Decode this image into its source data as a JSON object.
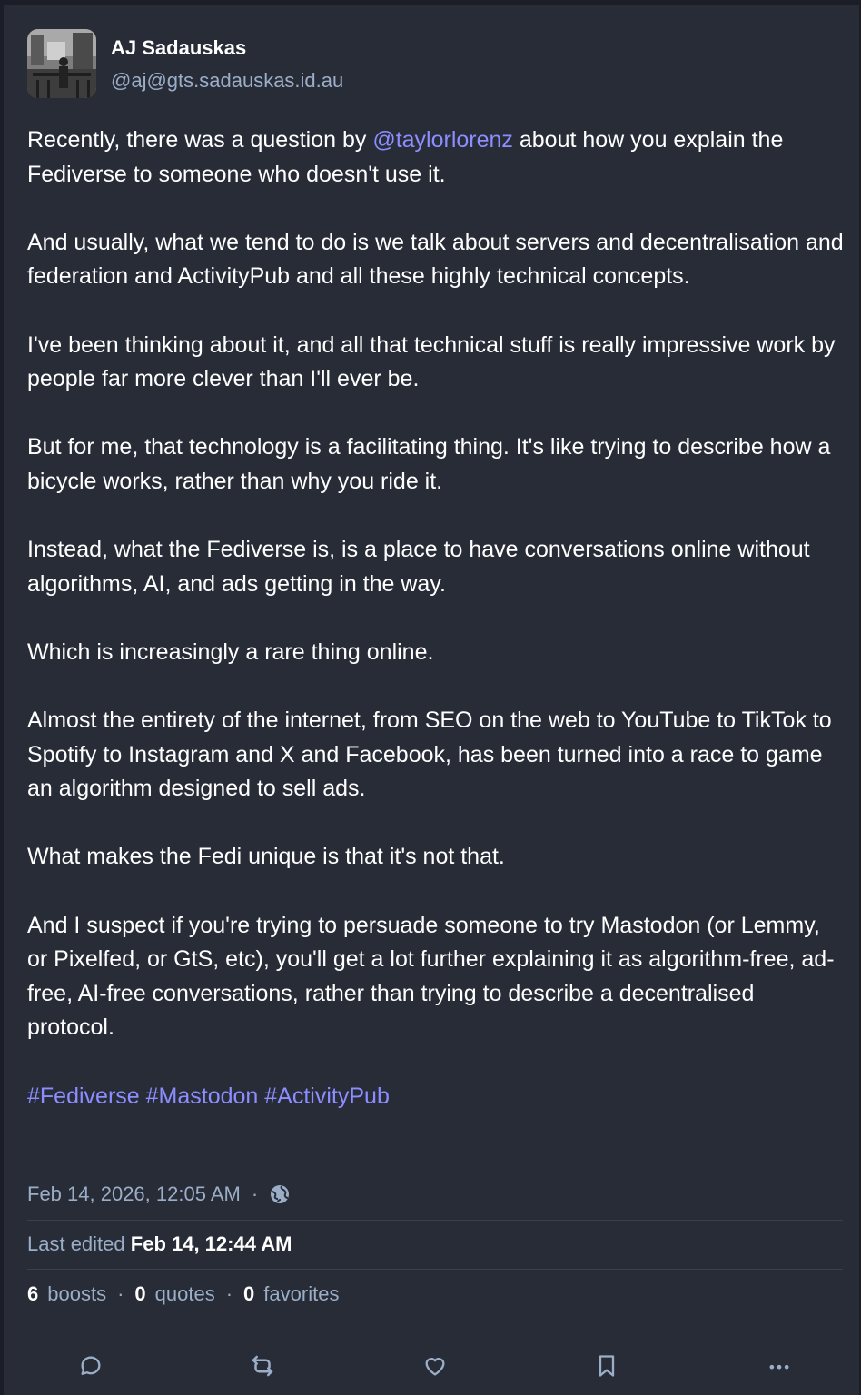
{
  "author": {
    "display_name": "AJ Sadauskas",
    "handle": "@aj@gts.sadauskas.id.au"
  },
  "post": {
    "p1_before": "Recently, there was a question by ",
    "mention": "@taylorlorenz",
    "p1_after": " about how you explain the Fediverse to someone who doesn't use it.",
    "p2": "And usually, what we tend to do is we talk about servers and decentralisation and federation and ActivityPub and all these highly technical concepts.",
    "p3": "I've been thinking about it, and all that technical stuff is really impressive work by people far more clever than I'll ever be.",
    "p4": "But for me, that technology is a facilitating thing. It's like trying to describe how a bicycle works, rather than why you ride it.",
    "p5": "Instead, what the Fediverse is, is a place to have conversations online without algorithms, AI, and ads getting in the way.",
    "p6": "Which is increasingly a rare thing online.",
    "p7": "Almost the entirety of the internet, from SEO on the web to YouTube to TikTok to Spotify to Instagram and X and Facebook, has been turned into a race to game an algorithm designed to sell ads.",
    "p8": "What makes the Fedi unique is that it's not that.",
    "p9": "And I suspect if you're trying to persuade someone to try Mastodon (or Lemmy, or Pixelfed, or GtS, etc), you'll get a lot further explaining it as algorithm-free, ad-free, AI-free conversations, rather than trying to describe a decentralised protocol.",
    "hashtags": [
      "#Fediverse",
      "#Mastodon",
      "#ActivityPub"
    ]
  },
  "meta": {
    "timestamp": "Feb 14, 2026, 12:05 AM",
    "separator": "·",
    "visibility_icon": "globe-icon",
    "edited_label": "Last edited",
    "edited_time": "Feb 14, 12:44 AM"
  },
  "stats": {
    "boosts_count": "6",
    "boosts_label": "boosts",
    "quotes_count": "0",
    "quotes_label": "quotes",
    "favorites_count": "0",
    "favorites_label": "favorites",
    "separator": "·"
  },
  "actions": [
    "reply-icon",
    "boost-icon",
    "favorite-icon",
    "bookmark-icon",
    "more-icon"
  ],
  "colors": {
    "background": "#282c37",
    "link": "#8c8dff",
    "muted": "#9baec8",
    "text": "#ffffff"
  }
}
